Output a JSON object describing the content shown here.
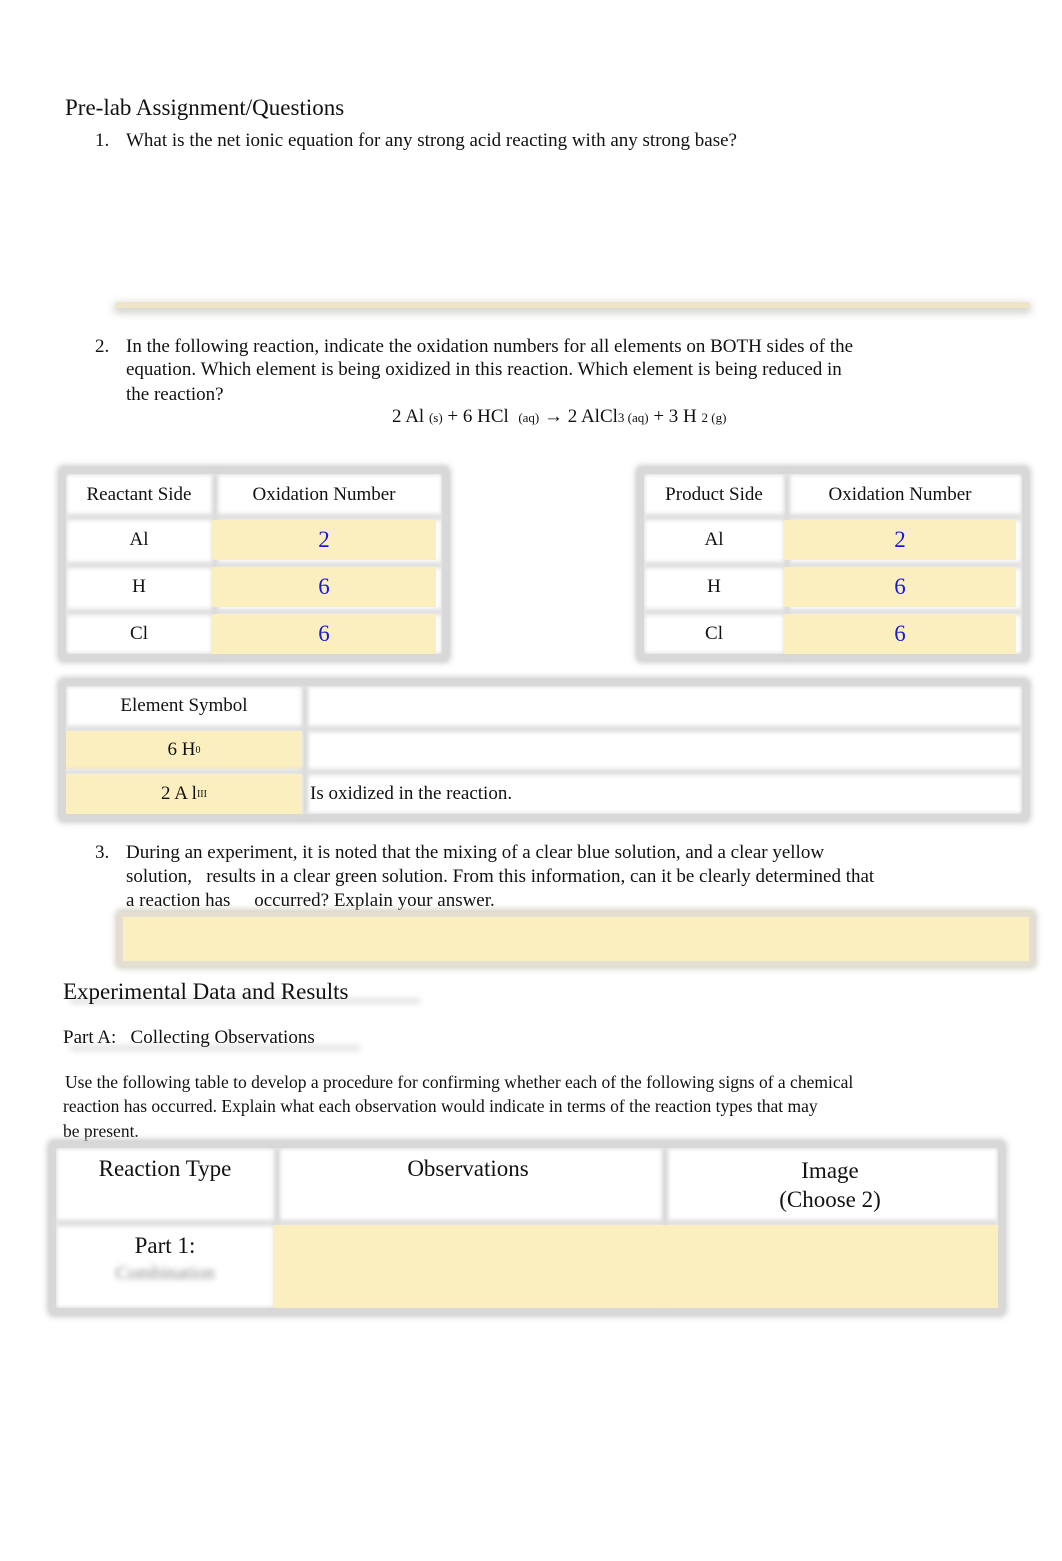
{
  "section_prelab": {
    "heading": "Pre-lab Assignment/Questions",
    "questions": [
      {
        "number": "1.",
        "text": "What is the net ionic equation for any strong acid reacting with any strong base?"
      },
      {
        "number": "2.",
        "lines": [
          "In the following reaction, indicate the oxidation numbers for all elements on BOTH sides of the",
          "equation. Which element is being oxidized in this reaction. Which element is being reduced in",
          "the reaction?"
        ]
      },
      {
        "number": "3.",
        "lines": [
          "During an experiment, it is noted that the mixing of a clear blue solution, and a clear yellow",
          "solution,   results in a clear green solution. From this information, can it be clearly determined that",
          "a reaction has     occurred? Explain your answer."
        ]
      }
    ]
  },
  "equation": {
    "al_coef": "2 Al",
    "al_state": "(s)",
    "plus1": "+ 6 HCl",
    "hcl_state": "(aq)",
    "arrow": "→",
    "alcl": "2 AlCl",
    "alcl_sub": "3 (aq)",
    "plus2": "+ 3 H",
    "h_sub": "2 (g)"
  },
  "reactant_table": {
    "headers": [
      "Reactant Side",
      "Oxidation Number"
    ],
    "rows": [
      {
        "element": "Al",
        "value": "2"
      },
      {
        "element": "H",
        "value": "6"
      },
      {
        "element": "Cl",
        "value": "6"
      }
    ]
  },
  "product_table": {
    "headers": [
      "Product Side",
      "Oxidation Number"
    ],
    "rows": [
      {
        "element": "Al",
        "value": "2"
      },
      {
        "element": "H",
        "value": "6"
      },
      {
        "element": "Cl",
        "value": "6"
      }
    ]
  },
  "element_table": {
    "header": "Element Symbol",
    "rows": [
      {
        "symbol": "6 H",
        "sup": "0",
        "description": ""
      },
      {
        "symbol": "2 A l",
        "sup": "III",
        "description": "Is oxidized in the reaction."
      }
    ]
  },
  "section_experimental": {
    "heading": "Experimental Data and Results",
    "part_a": "Part A:   Collecting Observations",
    "instructions": [
      "Use the following table to develop a procedure for confirming whether each of the following signs of a chemical",
      "reaction has occurred. Explain what each observation would indicate in terms of the reaction types that may",
      "be present."
    ]
  },
  "observation_table": {
    "headers": [
      "Reaction Type",
      "Observations",
      "Image",
      "(Choose 2)"
    ],
    "rows": [
      {
        "reaction_type": "Part 1:",
        "subtitle": "Combination",
        "observations": "",
        "image": ""
      }
    ]
  },
  "colors": {
    "answer_fill": "#fcefbf",
    "answer_text": "#1a1adf",
    "border_gray": "#d8d8d8"
  }
}
